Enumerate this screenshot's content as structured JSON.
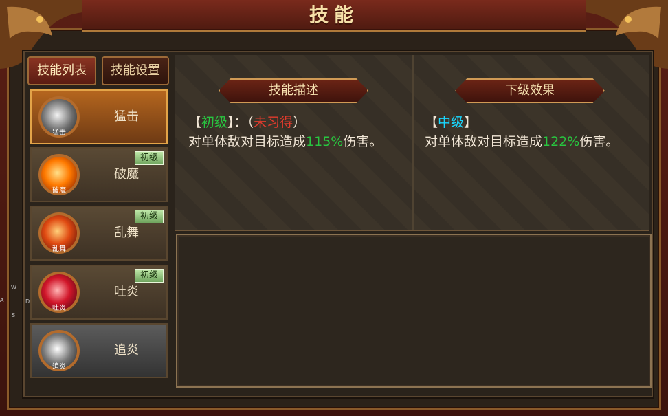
{
  "title": "技能",
  "tabs": {
    "list": "技能列表",
    "settings": "技能设置"
  },
  "skills": [
    {
      "name": "猛击",
      "icon_label": "猛击",
      "badge": "",
      "selected": true,
      "icon": "grey-vortex-icon"
    },
    {
      "name": "破魔",
      "icon_label": "破魔",
      "badge": "初级",
      "selected": false,
      "icon": "fire-swirl-icon"
    },
    {
      "name": "乱舞",
      "icon_label": "乱舞",
      "badge": "初级",
      "selected": false,
      "icon": "red-swirl-icon"
    },
    {
      "name": "吐炎",
      "icon_label": "吐炎",
      "badge": "初级",
      "selected": false,
      "icon": "crimson-burst-icon"
    },
    {
      "name": "追炎",
      "icon_label": "追炎",
      "badge": "",
      "selected": false,
      "icon": "grey-burst-icon"
    }
  ],
  "sections": {
    "description": "技能描述",
    "next_level": "下级效果"
  },
  "current": {
    "bracket_open": "【",
    "level": "初级",
    "bracket_close": "】：",
    "status_open": "（",
    "status": "未习得",
    "status_close": "）",
    "text_prefix": "对单体敌对目标造成",
    "value": "115%",
    "text_suffix": "伤害。"
  },
  "next": {
    "bracket_open": "【",
    "level": "中级",
    "bracket_close": "】",
    "text_prefix": "对单体敌对目标造成",
    "value": "122%",
    "text_suffix": "伤害。"
  },
  "side_keys": {
    "w": "W",
    "a": "A",
    "d": "D",
    "s": "S"
  }
}
